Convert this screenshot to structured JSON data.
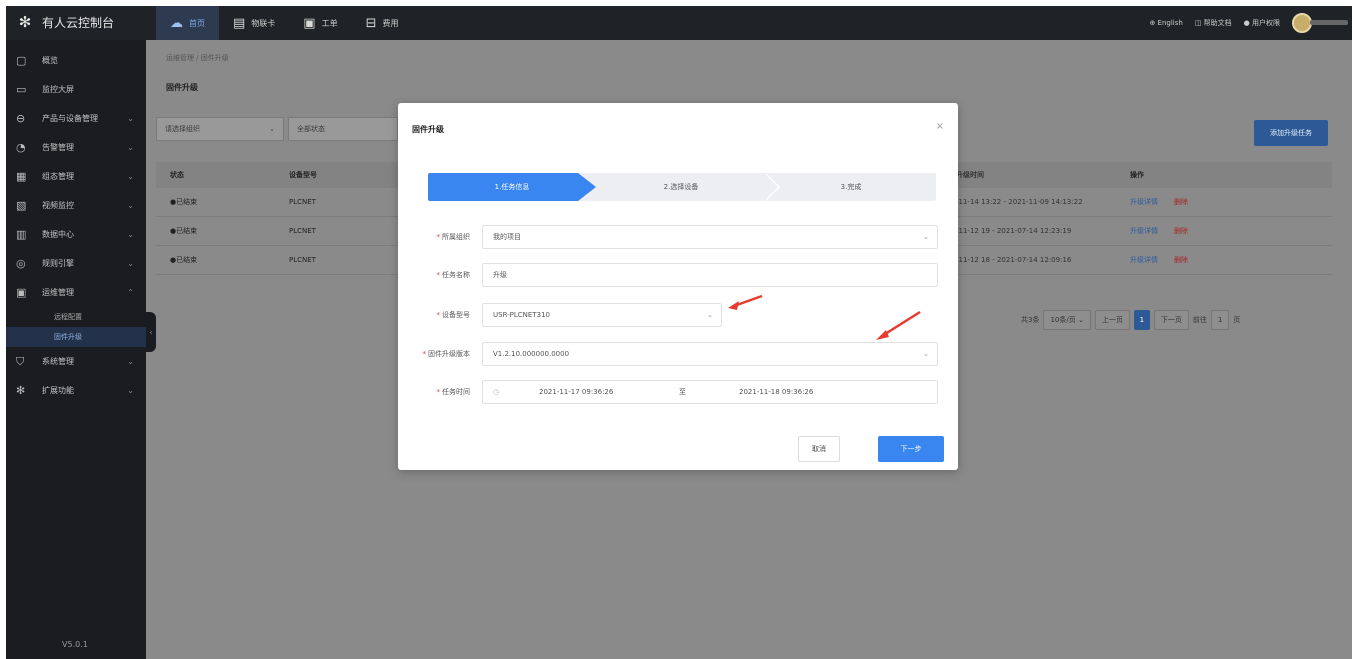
{
  "topbar": {
    "logo_text": "有人云控制台",
    "nav": [
      {
        "label": "首页",
        "icon": "cloud-icon",
        "active": true
      },
      {
        "label": "物联卡",
        "icon": "sim-card-icon",
        "active": false
      },
      {
        "label": "工单",
        "icon": "ticket-icon",
        "active": false
      },
      {
        "label": "费用",
        "icon": "wallet-icon",
        "active": false
      }
    ],
    "right": {
      "language": "English",
      "help": "帮助文档",
      "account": "用户权限"
    }
  },
  "sidebar": {
    "items": [
      {
        "label": "概览",
        "icon": "dashboard-icon"
      },
      {
        "label": "监控大屏",
        "icon": "monitor-icon"
      },
      {
        "label": "产品与设备管理",
        "icon": "product-icon",
        "expandable": true
      },
      {
        "label": "告警管理",
        "icon": "alarm-icon",
        "expandable": true
      },
      {
        "label": "组态管理",
        "icon": "config-icon",
        "expandable": true
      },
      {
        "label": "视频监控",
        "icon": "video-icon",
        "expandable": true
      },
      {
        "label": "数据中心",
        "icon": "data-icon",
        "expandable": true
      },
      {
        "label": "规则引擎",
        "icon": "rule-icon",
        "expandable": true
      },
      {
        "label": "运维管理",
        "icon": "ops-icon",
        "expandable": true,
        "expanded": true
      }
    ],
    "subitems": [
      {
        "label": "远程配置",
        "active": false
      },
      {
        "label": "固件升级",
        "active": true
      }
    ],
    "items_after": [
      {
        "label": "系统管理",
        "icon": "shield-icon",
        "expandable": true
      },
      {
        "label": "扩展功能",
        "icon": "gear-icon",
        "expandable": true
      }
    ],
    "version": "V5.0.1"
  },
  "page": {
    "breadcrumb": "运维管理 / 固件升级",
    "title": "固件升级",
    "filters": [
      {
        "value": "请选择组织"
      },
      {
        "value": "全部状态"
      }
    ],
    "add_button": "添加升级任务",
    "table": {
      "headers": [
        "状态",
        "设备型号",
        "升级时间",
        "操作"
      ],
      "rows": [
        {
          "status": "●已结束",
          "model": "PLCNET",
          "time": "-11-14 13:22 - 2021-11-09 14:13:22",
          "action1": "升级详情",
          "action2": "删除"
        },
        {
          "status": "●已结束",
          "model": "PLCNET",
          "time": "-11-12 19 - 2021-07-14 12:23:19",
          "action1": "升级详情",
          "action2": "删除"
        },
        {
          "status": "●已结束",
          "model": "PLCNET",
          "time": "-11-12 18 - 2021-07-14 12:09:16",
          "action1": "升级详情",
          "action2": "删除"
        }
      ]
    },
    "pagination": {
      "total": "共3条",
      "page_size": "10条/页",
      "prev": "上一页",
      "current": "1",
      "next": "下一页",
      "goto_label": "前往",
      "goto_value": "1",
      "page_suffix": "页"
    }
  },
  "modal": {
    "title": "固件升级",
    "close": "×",
    "steps": [
      "1.任务信息",
      "2.选择设备",
      "3.完成"
    ],
    "fields": {
      "org": {
        "label": "所属组织",
        "value": "我的项目"
      },
      "task_name": {
        "label": "任务名称",
        "value": "升级"
      },
      "device_model": {
        "label": "设备型号",
        "value": "USR-PLCNET310"
      },
      "firmware_version": {
        "label": "固件升级版本",
        "value": "V1.2.10.000000.0000"
      },
      "task_time": {
        "label": "任务时间",
        "start": "2021-11-17 09:36:26",
        "separator": "至",
        "end": "2021-11-18 09:36:26"
      }
    },
    "cancel": "取消",
    "next": "下一步"
  },
  "colors": {
    "primary": "#3a86f0",
    "danger": "#e23a3a",
    "arrow": "#e63b2e",
    "sidebar_bg": "#1a1c1f"
  }
}
